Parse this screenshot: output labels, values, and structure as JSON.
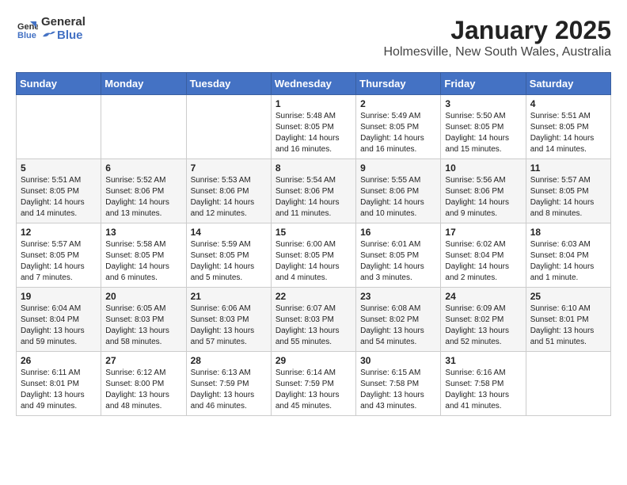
{
  "header": {
    "logo_general": "General",
    "logo_blue": "Blue",
    "month_title": "January 2025",
    "location": "Holmesville, New South Wales, Australia"
  },
  "weekdays": [
    "Sunday",
    "Monday",
    "Tuesday",
    "Wednesday",
    "Thursday",
    "Friday",
    "Saturday"
  ],
  "weeks": [
    [
      {
        "day": "",
        "info": ""
      },
      {
        "day": "",
        "info": ""
      },
      {
        "day": "",
        "info": ""
      },
      {
        "day": "1",
        "info": "Sunrise: 5:48 AM\nSunset: 8:05 PM\nDaylight: 14 hours\nand 16 minutes."
      },
      {
        "day": "2",
        "info": "Sunrise: 5:49 AM\nSunset: 8:05 PM\nDaylight: 14 hours\nand 16 minutes."
      },
      {
        "day": "3",
        "info": "Sunrise: 5:50 AM\nSunset: 8:05 PM\nDaylight: 14 hours\nand 15 minutes."
      },
      {
        "day": "4",
        "info": "Sunrise: 5:51 AM\nSunset: 8:05 PM\nDaylight: 14 hours\nand 14 minutes."
      }
    ],
    [
      {
        "day": "5",
        "info": "Sunrise: 5:51 AM\nSunset: 8:05 PM\nDaylight: 14 hours\nand 14 minutes."
      },
      {
        "day": "6",
        "info": "Sunrise: 5:52 AM\nSunset: 8:06 PM\nDaylight: 14 hours\nand 13 minutes."
      },
      {
        "day": "7",
        "info": "Sunrise: 5:53 AM\nSunset: 8:06 PM\nDaylight: 14 hours\nand 12 minutes."
      },
      {
        "day": "8",
        "info": "Sunrise: 5:54 AM\nSunset: 8:06 PM\nDaylight: 14 hours\nand 11 minutes."
      },
      {
        "day": "9",
        "info": "Sunrise: 5:55 AM\nSunset: 8:06 PM\nDaylight: 14 hours\nand 10 minutes."
      },
      {
        "day": "10",
        "info": "Sunrise: 5:56 AM\nSunset: 8:06 PM\nDaylight: 14 hours\nand 9 minutes."
      },
      {
        "day": "11",
        "info": "Sunrise: 5:57 AM\nSunset: 8:05 PM\nDaylight: 14 hours\nand 8 minutes."
      }
    ],
    [
      {
        "day": "12",
        "info": "Sunrise: 5:57 AM\nSunset: 8:05 PM\nDaylight: 14 hours\nand 7 minutes."
      },
      {
        "day": "13",
        "info": "Sunrise: 5:58 AM\nSunset: 8:05 PM\nDaylight: 14 hours\nand 6 minutes."
      },
      {
        "day": "14",
        "info": "Sunrise: 5:59 AM\nSunset: 8:05 PM\nDaylight: 14 hours\nand 5 minutes."
      },
      {
        "day": "15",
        "info": "Sunrise: 6:00 AM\nSunset: 8:05 PM\nDaylight: 14 hours\nand 4 minutes."
      },
      {
        "day": "16",
        "info": "Sunrise: 6:01 AM\nSunset: 8:05 PM\nDaylight: 14 hours\nand 3 minutes."
      },
      {
        "day": "17",
        "info": "Sunrise: 6:02 AM\nSunset: 8:04 PM\nDaylight: 14 hours\nand 2 minutes."
      },
      {
        "day": "18",
        "info": "Sunrise: 6:03 AM\nSunset: 8:04 PM\nDaylight: 14 hours\nand 1 minute."
      }
    ],
    [
      {
        "day": "19",
        "info": "Sunrise: 6:04 AM\nSunset: 8:04 PM\nDaylight: 13 hours\nand 59 minutes."
      },
      {
        "day": "20",
        "info": "Sunrise: 6:05 AM\nSunset: 8:03 PM\nDaylight: 13 hours\nand 58 minutes."
      },
      {
        "day": "21",
        "info": "Sunrise: 6:06 AM\nSunset: 8:03 PM\nDaylight: 13 hours\nand 57 minutes."
      },
      {
        "day": "22",
        "info": "Sunrise: 6:07 AM\nSunset: 8:03 PM\nDaylight: 13 hours\nand 55 minutes."
      },
      {
        "day": "23",
        "info": "Sunrise: 6:08 AM\nSunset: 8:02 PM\nDaylight: 13 hours\nand 54 minutes."
      },
      {
        "day": "24",
        "info": "Sunrise: 6:09 AM\nSunset: 8:02 PM\nDaylight: 13 hours\nand 52 minutes."
      },
      {
        "day": "25",
        "info": "Sunrise: 6:10 AM\nSunset: 8:01 PM\nDaylight: 13 hours\nand 51 minutes."
      }
    ],
    [
      {
        "day": "26",
        "info": "Sunrise: 6:11 AM\nSunset: 8:01 PM\nDaylight: 13 hours\nand 49 minutes."
      },
      {
        "day": "27",
        "info": "Sunrise: 6:12 AM\nSunset: 8:00 PM\nDaylight: 13 hours\nand 48 minutes."
      },
      {
        "day": "28",
        "info": "Sunrise: 6:13 AM\nSunset: 7:59 PM\nDaylight: 13 hours\nand 46 minutes."
      },
      {
        "day": "29",
        "info": "Sunrise: 6:14 AM\nSunset: 7:59 PM\nDaylight: 13 hours\nand 45 minutes."
      },
      {
        "day": "30",
        "info": "Sunrise: 6:15 AM\nSunset: 7:58 PM\nDaylight: 13 hours\nand 43 minutes."
      },
      {
        "day": "31",
        "info": "Sunrise: 6:16 AM\nSunset: 7:58 PM\nDaylight: 13 hours\nand 41 minutes."
      },
      {
        "day": "",
        "info": ""
      }
    ]
  ]
}
